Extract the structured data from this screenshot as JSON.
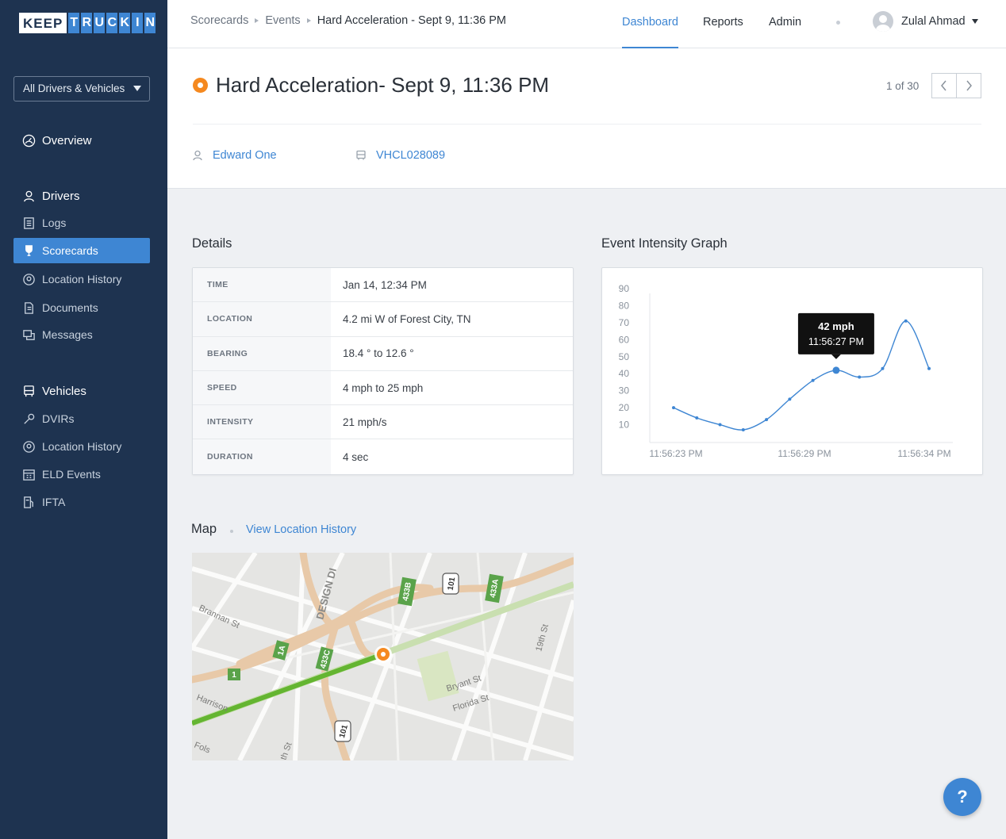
{
  "brand": {
    "keep": "KEEP",
    "truckin": [
      "T",
      "R",
      "U",
      "C",
      "K",
      "I",
      "N"
    ]
  },
  "sidebar": {
    "filter": "All Drivers & Vehicles",
    "overview": "Overview",
    "drivers_section": "Drivers",
    "driver_items": [
      {
        "label": "Logs",
        "icon": "logs-icon"
      },
      {
        "label": "Scorecards",
        "icon": "trophy-icon",
        "active": true
      },
      {
        "label": "Location History",
        "icon": "location-pin-icon"
      },
      {
        "label": "Documents",
        "icon": "document-icon"
      },
      {
        "label": "Messages",
        "icon": "messages-icon"
      }
    ],
    "vehicles_section": "Vehicles",
    "vehicle_items": [
      {
        "label": "DVIRs",
        "icon": "wrench-icon"
      },
      {
        "label": "Location History",
        "icon": "location-pin-icon"
      },
      {
        "label": "ELD Events",
        "icon": "calendar-icon"
      },
      {
        "label": "IFTA",
        "icon": "fuel-icon"
      }
    ]
  },
  "header": {
    "breadcrumb": [
      "Scorecards",
      "Events",
      "Hard Acceleration - Sept 9, 11:36 PM"
    ],
    "nav": [
      "Dashboard",
      "Reports",
      "Admin"
    ],
    "active_nav": "Dashboard",
    "user": "Zulal Ahmad"
  },
  "event": {
    "title": "Hard Acceleration- Sept 9, 11:36 PM",
    "pager": "1 of 30",
    "driver": "Edward One",
    "vehicle": "VHCL028089",
    "accent": "#f5891f"
  },
  "details": {
    "title": "Details",
    "rows": [
      {
        "label": "TIME",
        "value": "Jan 14, 12:34 PM"
      },
      {
        "label": "LOCATION",
        "value": "4.2 mi W of Forest City, TN"
      },
      {
        "label": "BEARING",
        "value": "18.4 ° to 12.6 °"
      },
      {
        "label": "SPEED",
        "value": "4 mph to 25 mph"
      },
      {
        "label": "INTENSITY",
        "value": "21 mph/s"
      },
      {
        "label": "DURATION",
        "value": "4 sec"
      }
    ]
  },
  "graph": {
    "title": "Event Intensity Graph",
    "tooltip": {
      "value": "42 mph",
      "time": "11:56:27 PM"
    }
  },
  "chart_data": {
    "type": "line",
    "title": "Event Intensity Graph",
    "y_ticks": [
      90,
      80,
      70,
      60,
      50,
      40,
      30,
      20,
      10
    ],
    "x_tick_labels": [
      "11:56:23 PM",
      "11:56:29 PM",
      "11:56:34 PM"
    ],
    "ylim": [
      0,
      90
    ],
    "x": [
      0,
      1,
      2,
      3,
      4,
      5,
      6,
      7,
      8,
      9,
      10,
      11
    ],
    "series": [
      {
        "values": [
          20,
          14,
          10,
          7,
          13,
          25,
          36,
          42,
          38,
          43,
          71,
          43
        ]
      }
    ],
    "highlight_index": 7,
    "color": "#3e86d3"
  },
  "map": {
    "title": "Map",
    "link": "View Location History",
    "street_labels": [
      "Brannan St",
      "DESIGN DI",
      "Bryant St",
      "Florida St",
      "19th St",
      "Harrison",
      "Fols",
      "th St"
    ],
    "shields": [
      "433B",
      "101",
      "433A",
      "1A",
      "433C",
      "1",
      "101"
    ]
  },
  "help": "?"
}
